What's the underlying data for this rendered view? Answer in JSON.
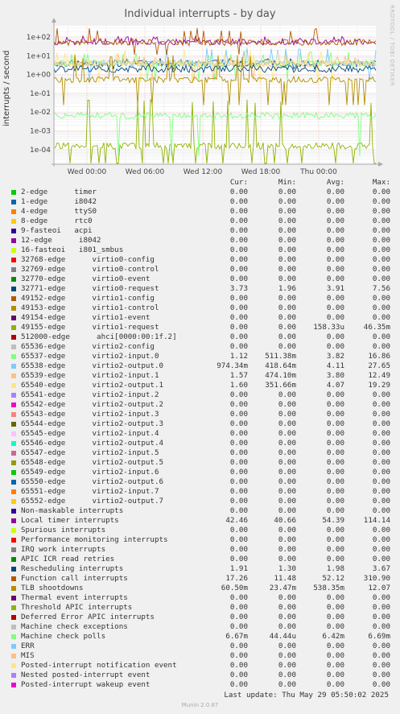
{
  "chart_data": {
    "type": "line",
    "title": "Individual interrupts - by day",
    "ylabel": "interrupts / second",
    "yscale": "log",
    "ylim": [
      3e-05,
      300
    ],
    "y_ticks": [
      "1e+02",
      "1e+01",
      "1e+00",
      "1e-01",
      "1e-02",
      "1e-03",
      "1e-04"
    ],
    "x_ticks": [
      "Wed 00:00",
      "Wed 06:00",
      "Wed 12:00",
      "Wed 18:00",
      "Thu 00:00"
    ],
    "watermark": "RRDTOOL / TOBI OETIKER",
    "columns": [
      "Cur:",
      "Min:",
      "Avg:",
      "Max:"
    ],
    "series": [
      {
        "name": "2-edge      timer",
        "color": "#00cc00",
        "values": [
          "0.00",
          "0.00",
          "0.00",
          "0.00"
        ]
      },
      {
        "name": "1-edge      i8042",
        "color": "#0066b3",
        "values": [
          "0.00",
          "0.00",
          "0.00",
          "0.00"
        ]
      },
      {
        "name": "4-edge      ttyS0",
        "color": "#ff8000",
        "values": [
          "0.00",
          "0.00",
          "0.00",
          "0.00"
        ]
      },
      {
        "name": "8-edge      rtc0",
        "color": "#ffcc00",
        "values": [
          "0.00",
          "0.00",
          "0.00",
          "0.00"
        ]
      },
      {
        "name": "9-fasteoi   acpi",
        "color": "#330099",
        "values": [
          "0.00",
          "0.00",
          "0.00",
          "0.00"
        ]
      },
      {
        "name": "12-edge      i8042",
        "color": "#990099",
        "values": [
          "0.00",
          "0.00",
          "0.00",
          "0.00"
        ]
      },
      {
        "name": "16-fasteoi   i801_smbus",
        "color": "#ccff00",
        "values": [
          "0.00",
          "0.00",
          "0.00",
          "0.00"
        ]
      },
      {
        "name": "32768-edge      virtio0-config",
        "color": "#ff0000",
        "values": [
          "0.00",
          "0.00",
          "0.00",
          "0.00"
        ]
      },
      {
        "name": "32769-edge      virtio0-control",
        "color": "#808080",
        "values": [
          "0.00",
          "0.00",
          "0.00",
          "0.00"
        ]
      },
      {
        "name": "32770-edge      virtio0-event",
        "color": "#008f00",
        "values": [
          "0.00",
          "0.00",
          "0.00",
          "0.00"
        ]
      },
      {
        "name": "32771-edge      virtio0-request",
        "color": "#00487d",
        "values": [
          "3.73",
          "1.96",
          "3.91",
          "7.56"
        ]
      },
      {
        "name": "49152-edge      virtio1-config",
        "color": "#b35a00",
        "values": [
          "0.00",
          "0.00",
          "0.00",
          "0.00"
        ]
      },
      {
        "name": "49153-edge      virtio1-control",
        "color": "#b38f00",
        "values": [
          "0.00",
          "0.00",
          "0.00",
          "0.00"
        ]
      },
      {
        "name": "49154-edge      virtio1-event",
        "color": "#6b006b",
        "values": [
          "0.00",
          "0.00",
          "0.00",
          "0.00"
        ]
      },
      {
        "name": "49155-edge      virtio1-request",
        "color": "#8fb300",
        "values": [
          "0.00",
          "0.00",
          "158.33u",
          "46.35m"
        ]
      },
      {
        "name": "512000-edge      ahci[0000:00:1f.2]",
        "color": "#b30000",
        "values": [
          "0.00",
          "0.00",
          "0.00",
          "0.00"
        ]
      },
      {
        "name": "65536-edge      virtio2-config",
        "color": "#bebebe",
        "values": [
          "0.00",
          "0.00",
          "0.00",
          "0.00"
        ]
      },
      {
        "name": "65537-edge      virtio2-input.0",
        "color": "#80ff80",
        "values": [
          "1.12",
          "511.38m",
          "3.82",
          "16.86"
        ]
      },
      {
        "name": "65538-edge      virtio2-output.0",
        "color": "#80c9ff",
        "values": [
          "974.34m",
          "418.64m",
          "4.11",
          "27.65"
        ]
      },
      {
        "name": "65539-edge      virtio2-input.1",
        "color": "#ffc080",
        "values": [
          "1.57",
          "474.10m",
          "3.80",
          "12.49"
        ]
      },
      {
        "name": "65540-edge      virtio2-output.1",
        "color": "#ffe680",
        "values": [
          "1.60",
          "351.66m",
          "4.07",
          "19.29"
        ]
      },
      {
        "name": "65541-edge      virtio2-input.2",
        "color": "#aa80ff",
        "values": [
          "0.00",
          "0.00",
          "0.00",
          "0.00"
        ]
      },
      {
        "name": "65542-edge      virtio2-output.2",
        "color": "#ee00cc",
        "values": [
          "0.00",
          "0.00",
          "0.00",
          "0.00"
        ]
      },
      {
        "name": "65543-edge      virtio2-input.3",
        "color": "#ff8080",
        "values": [
          "0.00",
          "0.00",
          "0.00",
          "0.00"
        ]
      },
      {
        "name": "65544-edge      virtio2-output.3",
        "color": "#666600",
        "values": [
          "0.00",
          "0.00",
          "0.00",
          "0.00"
        ]
      },
      {
        "name": "65545-edge      virtio2-input.4",
        "color": "#ffbfff",
        "values": [
          "0.00",
          "0.00",
          "0.00",
          "0.00"
        ]
      },
      {
        "name": "65546-edge      virtio2-output.4",
        "color": "#00ffcc",
        "values": [
          "0.00",
          "0.00",
          "0.00",
          "0.00"
        ]
      },
      {
        "name": "65547-edge      virtio2-input.5",
        "color": "#cc6699",
        "values": [
          "0.00",
          "0.00",
          "0.00",
          "0.00"
        ]
      },
      {
        "name": "65548-edge      virtio2-output.5",
        "color": "#999900",
        "values": [
          "0.00",
          "0.00",
          "0.00",
          "0.00"
        ]
      },
      {
        "name": "65549-edge      virtio2-input.6",
        "color": "#00cc00",
        "values": [
          "0.00",
          "0.00",
          "0.00",
          "0.00"
        ]
      },
      {
        "name": "65550-edge      virtio2-output.6",
        "color": "#0066b3",
        "values": [
          "0.00",
          "0.00",
          "0.00",
          "0.00"
        ]
      },
      {
        "name": "65551-edge      virtio2-input.7",
        "color": "#ff8000",
        "values": [
          "0.00",
          "0.00",
          "0.00",
          "0.00"
        ]
      },
      {
        "name": "65552-edge      virtio2-output.7",
        "color": "#ffcc00",
        "values": [
          "0.00",
          "0.00",
          "0.00",
          "0.00"
        ]
      },
      {
        "name": "Non-maskable interrupts",
        "color": "#330099",
        "values": [
          "0.00",
          "0.00",
          "0.00",
          "0.00"
        ]
      },
      {
        "name": "Local timer interrupts",
        "color": "#990099",
        "values": [
          "42.46",
          "40.66",
          "54.39",
          "114.14"
        ]
      },
      {
        "name": "Spurious interrupts",
        "color": "#ccff00",
        "values": [
          "0.00",
          "0.00",
          "0.00",
          "0.00"
        ]
      },
      {
        "name": "Performance monitoring interrupts",
        "color": "#ff0000",
        "values": [
          "0.00",
          "0.00",
          "0.00",
          "0.00"
        ]
      },
      {
        "name": "IRQ work interrupts",
        "color": "#808080",
        "values": [
          "0.00",
          "0.00",
          "0.00",
          "0.00"
        ]
      },
      {
        "name": "APIC ICR read retries",
        "color": "#008f00",
        "values": [
          "0.00",
          "0.00",
          "0.00",
          "0.00"
        ]
      },
      {
        "name": "Rescheduling interrupts",
        "color": "#00487d",
        "values": [
          "1.91",
          "1.30",
          "1.98",
          "3.67"
        ]
      },
      {
        "name": "Function call interrupts",
        "color": "#b35a00",
        "values": [
          "17.26",
          "11.48",
          "52.12",
          "310.90"
        ]
      },
      {
        "name": "TLB shootdowns",
        "color": "#b38f00",
        "values": [
          "60.50m",
          "23.47m",
          "538.35m",
          "12.07"
        ]
      },
      {
        "name": "Thermal event interrupts",
        "color": "#6b006b",
        "values": [
          "0.00",
          "0.00",
          "0.00",
          "0.00"
        ]
      },
      {
        "name": "Threshold APIC interrupts",
        "color": "#8fb300",
        "values": [
          "0.00",
          "0.00",
          "0.00",
          "0.00"
        ]
      },
      {
        "name": "Deferred Error APIC interrupts",
        "color": "#b30000",
        "values": [
          "0.00",
          "0.00",
          "0.00",
          "0.00"
        ]
      },
      {
        "name": "Machine check exceptions",
        "color": "#bebebe",
        "values": [
          "0.00",
          "0.00",
          "0.00",
          "0.00"
        ]
      },
      {
        "name": "Machine check polls",
        "color": "#80ff80",
        "values": [
          "6.67m",
          "44.44u",
          "6.42m",
          "6.69m"
        ]
      },
      {
        "name": "ERR",
        "color": "#80c9ff",
        "values": [
          "0.00",
          "0.00",
          "0.00",
          "0.00"
        ]
      },
      {
        "name": "MIS",
        "color": "#ffc080",
        "values": [
          "0.00",
          "0.00",
          "0.00",
          "0.00"
        ]
      },
      {
        "name": "Posted-interrupt notification event",
        "color": "#ffe680",
        "values": [
          "0.00",
          "0.00",
          "0.00",
          "0.00"
        ]
      },
      {
        "name": "Nested posted-interrupt event",
        "color": "#aa80ff",
        "values": [
          "0.00",
          "0.00",
          "0.00",
          "0.00"
        ]
      },
      {
        "name": "Posted-interrupt wakeup event",
        "color": "#ee00cc",
        "values": [
          "0.00",
          "0.00",
          "0.00",
          "0.00"
        ]
      }
    ]
  },
  "footer": {
    "last_update": "Last update: Thu May 29 05:50:02 2025",
    "munin_version": "Munin 2.0.67"
  }
}
